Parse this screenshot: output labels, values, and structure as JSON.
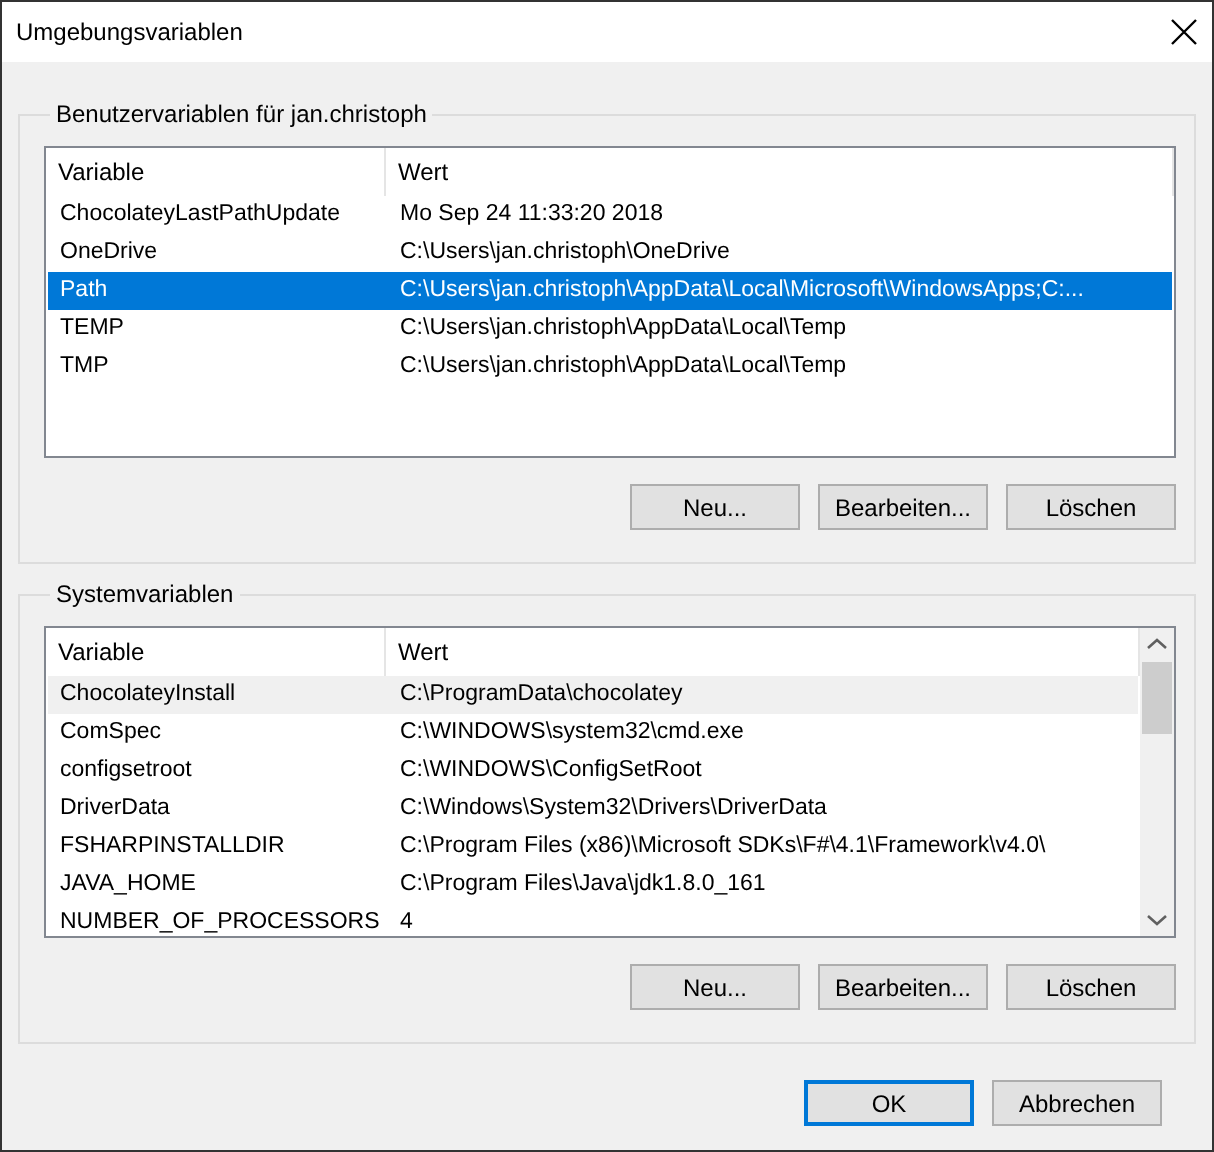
{
  "window": {
    "title": "Umgebungsvariablen"
  },
  "user_group": {
    "title": "Benutzervariablen für jan.christoph",
    "focused": true,
    "columns": [
      "Variable",
      "Wert"
    ],
    "rows": [
      {
        "variable": "ChocolateyLastPathUpdate",
        "value": "Mo Sep 24 11:33:20 2018",
        "selected": false
      },
      {
        "variable": "OneDrive",
        "value": "C:\\Users\\jan.christoph\\OneDrive",
        "selected": false
      },
      {
        "variable": "Path",
        "value": "C:\\Users\\jan.christoph\\AppData\\Local\\Microsoft\\WindowsApps;C:...",
        "selected": true
      },
      {
        "variable": "TEMP",
        "value": "C:\\Users\\jan.christoph\\AppData\\Local\\Temp",
        "selected": false
      },
      {
        "variable": "TMP",
        "value": "C:\\Users\\jan.christoph\\AppData\\Local\\Temp",
        "selected": false
      }
    ],
    "buttons": [
      "Neu...",
      "Bearbeiten...",
      "Löschen"
    ]
  },
  "system_group": {
    "title": "Systemvariablen",
    "focused": false,
    "columns": [
      "Variable",
      "Wert"
    ],
    "rows": [
      {
        "variable": "ChocolateyInstall",
        "value": "C:\\ProgramData\\chocolatey",
        "selected": true
      },
      {
        "variable": "ComSpec",
        "value": "C:\\WINDOWS\\system32\\cmd.exe",
        "selected": false
      },
      {
        "variable": "configsetroot",
        "value": "C:\\WINDOWS\\ConfigSetRoot",
        "selected": false
      },
      {
        "variable": "DriverData",
        "value": "C:\\Windows\\System32\\Drivers\\DriverData",
        "selected": false
      },
      {
        "variable": "FSHARPINSTALLDIR",
        "value": "C:\\Program Files (x86)\\Microsoft SDKs\\F#\\4.1\\Framework\\v4.0\\",
        "selected": false
      },
      {
        "variable": "JAVA_HOME",
        "value": "C:\\Program Files\\Java\\jdk1.8.0_161",
        "selected": false
      },
      {
        "variable": "NUMBER_OF_PROCESSORS",
        "value": "4",
        "selected": false
      }
    ],
    "buttons": [
      "Neu...",
      "Bearbeiten...",
      "Löschen"
    ]
  },
  "dialog_buttons": [
    {
      "label": "OK",
      "default": true
    },
    {
      "label": "Abbrechen",
      "default": false
    }
  ]
}
